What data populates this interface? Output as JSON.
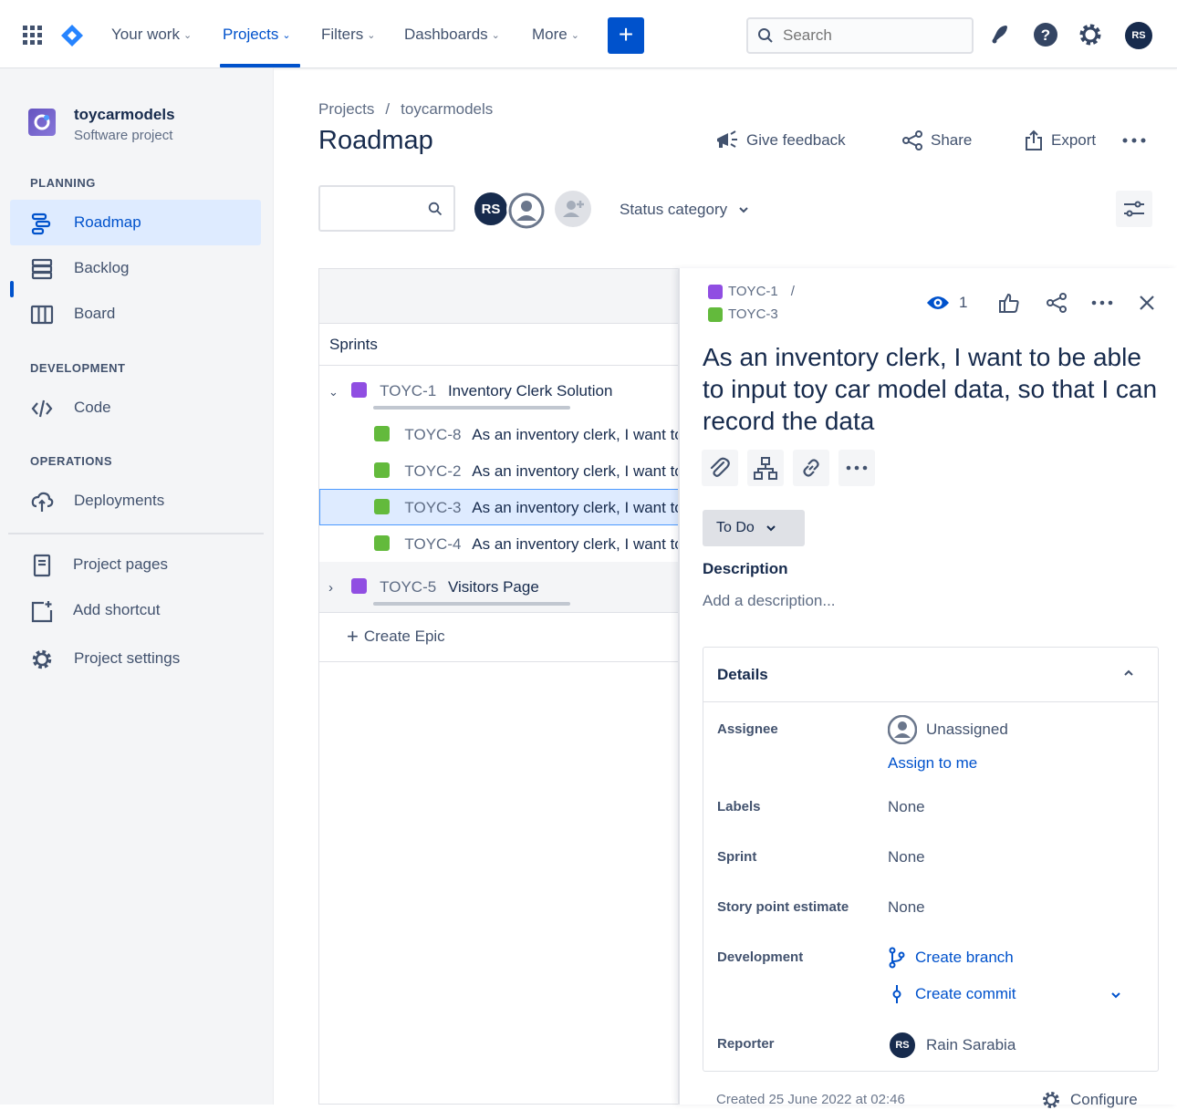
{
  "nav": {
    "your_work": "Your work",
    "projects": "Projects",
    "filters": "Filters",
    "dashboards": "Dashboards",
    "more": "More",
    "create": "+",
    "search_placeholder": "Search",
    "user_initials": "RS"
  },
  "sidebar": {
    "project_name": "toycarmodels",
    "project_type": "Software project",
    "planning": "PLANNING",
    "roadmap": "Roadmap",
    "backlog": "Backlog",
    "board": "Board",
    "development": "DEVELOPMENT",
    "code": "Code",
    "operations": "OPERATIONS",
    "deployments": "Deployments",
    "project_pages": "Project pages",
    "add_shortcut": "Add shortcut",
    "project_settings": "Project settings"
  },
  "header": {
    "crumb_projects": "Projects",
    "crumb_sep": "/",
    "crumb_project": "toycarmodels",
    "title": "Roadmap",
    "give_feedback": "Give feedback",
    "share": "Share",
    "export": "Export",
    "status_category": "Status category",
    "avatar_initials": "RS"
  },
  "roadmap": {
    "sprints_label": "Sprints",
    "rows": [
      {
        "key": "TOYC-1",
        "summary": "Inventory Clerk Solution"
      },
      {
        "key": "TOYC-8",
        "summary": "As an inventory clerk, I want to be able"
      },
      {
        "key": "TOYC-2",
        "summary": "As an inventory clerk, I want to be able"
      },
      {
        "key": "TOYC-3",
        "summary": "As an inventory clerk, I want to be able"
      },
      {
        "key": "TOYC-4",
        "summary": "As an inventory clerk, I want to be able"
      },
      {
        "key": "TOYC-5",
        "summary": "Visitors Page"
      }
    ],
    "create_epic": "Create Epic"
  },
  "detail": {
    "parent_key": "TOYC-1",
    "breadcrumb_sep": "/",
    "issue_key": "TOYC-3",
    "watch_count": "1",
    "title": "As an inventory clerk, I want to be able to input toy car model data, so that I can record the data",
    "status": "To Do",
    "description_label": "Description",
    "description_placeholder": "Add a description...",
    "details_label": "Details",
    "assignee_label": "Assignee",
    "assignee_value": "Unassigned",
    "assign_to_me": "Assign to me",
    "labels_label": "Labels",
    "labels_value": "None",
    "sprint_label": "Sprint",
    "sprint_value": "None",
    "story_points_label": "Story point estimate",
    "story_points_value": "None",
    "development_label": "Development",
    "create_branch": "Create branch",
    "create_commit": "Create commit",
    "reporter_label": "Reporter",
    "reporter_initials": "RS",
    "reporter_name": "Rain Sarabia",
    "created": "Created 25 June 2022 at 02:46",
    "configure": "Configure"
  },
  "colors": {
    "brand_blue": "#0052CC",
    "epic_purple": "#904EE2",
    "story_green": "#63BA3C",
    "selected_row": "#DEEBFF"
  }
}
